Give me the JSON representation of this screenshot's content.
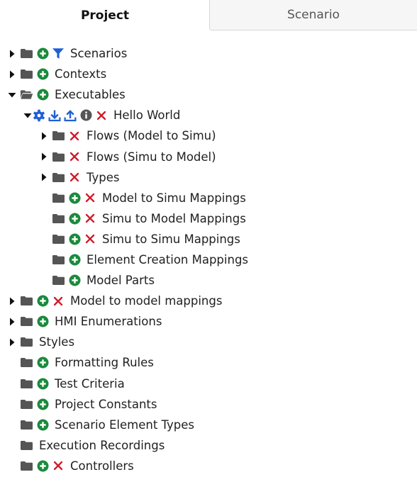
{
  "tabs": {
    "project": "Project",
    "scenario": "Scenario"
  },
  "colors": {
    "green": "#1a8a3c",
    "blue": "#1f5fd6",
    "red": "#d11a2a",
    "gray": "#555555"
  },
  "rows": [
    {
      "label": "Scenarios",
      "level": 0,
      "toggle": "collapsed",
      "icons": [
        "folder",
        "add-icon",
        "filter-icon"
      ]
    },
    {
      "label": "Contexts",
      "level": 0,
      "toggle": "collapsed",
      "icons": [
        "folder",
        "add-icon"
      ]
    },
    {
      "label": "Executables",
      "level": 0,
      "toggle": "expanded",
      "icons": [
        "folder-open",
        "add-icon"
      ]
    },
    {
      "label": "Hello World",
      "level": 1,
      "toggle": "expanded",
      "icons": [
        "gear-icon",
        "download-icon",
        "upload-icon",
        "info-icon",
        "delete-icon"
      ]
    },
    {
      "label": "Flows (Model to Simu)",
      "level": 2,
      "toggle": "collapsed",
      "icons": [
        "folder",
        "delete-icon"
      ]
    },
    {
      "label": "Flows (Simu to Model)",
      "level": 2,
      "toggle": "collapsed",
      "icons": [
        "folder",
        "delete-icon"
      ]
    },
    {
      "label": "Types",
      "level": 2,
      "toggle": "collapsed",
      "icons": [
        "folder",
        "delete-icon"
      ]
    },
    {
      "label": "Model to Simu Mappings",
      "level": 2,
      "toggle": "none",
      "icons": [
        "folder",
        "add-icon",
        "delete-icon"
      ]
    },
    {
      "label": "Simu to Model Mappings",
      "level": 2,
      "toggle": "none",
      "icons": [
        "folder",
        "add-icon",
        "delete-icon"
      ]
    },
    {
      "label": "Simu to Simu Mappings",
      "level": 2,
      "toggle": "none",
      "icons": [
        "folder",
        "add-icon",
        "delete-icon"
      ]
    },
    {
      "label": "Element Creation Mappings",
      "level": 2,
      "toggle": "none",
      "icons": [
        "folder",
        "add-icon"
      ]
    },
    {
      "label": "Model Parts",
      "level": 2,
      "toggle": "none",
      "icons": [
        "folder",
        "add-icon"
      ]
    },
    {
      "label": "Model to model mappings",
      "level": 0,
      "toggle": "collapsed",
      "icons": [
        "folder",
        "add-icon",
        "delete-icon"
      ]
    },
    {
      "label": "HMI Enumerations",
      "level": 0,
      "toggle": "collapsed",
      "icons": [
        "folder",
        "add-icon"
      ]
    },
    {
      "label": "Styles",
      "level": 0,
      "toggle": "collapsed",
      "icons": [
        "folder"
      ]
    },
    {
      "label": "Formatting Rules",
      "level": 0,
      "toggle": "none",
      "icons": [
        "folder",
        "add-icon"
      ]
    },
    {
      "label": "Test Criteria",
      "level": 0,
      "toggle": "none",
      "icons": [
        "folder",
        "add-icon"
      ]
    },
    {
      "label": "Project Constants",
      "level": 0,
      "toggle": "none",
      "icons": [
        "folder",
        "add-icon"
      ]
    },
    {
      "label": "Scenario Element Types",
      "level": 0,
      "toggle": "none",
      "icons": [
        "folder",
        "add-icon"
      ]
    },
    {
      "label": "Execution Recordings",
      "level": 0,
      "toggle": "none",
      "icons": [
        "folder"
      ]
    },
    {
      "label": "Controllers",
      "level": 0,
      "toggle": "none",
      "icons": [
        "folder",
        "add-icon",
        "delete-icon"
      ]
    }
  ]
}
